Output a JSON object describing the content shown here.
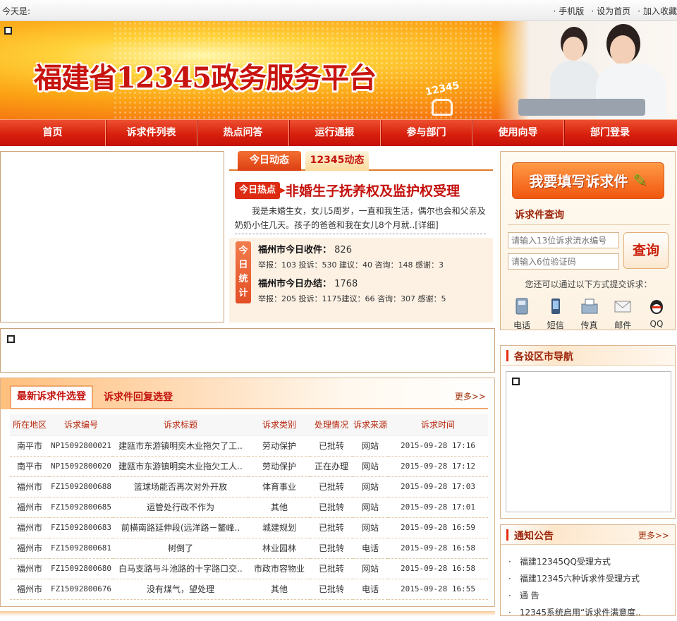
{
  "topbar": {
    "today": "今天是:",
    "links": [
      "手机版",
      "设为首页",
      "加入收藏"
    ]
  },
  "banner": {
    "title": "福建省12345政务服务平台",
    "phone_label": "12345"
  },
  "nav": [
    "首页",
    "诉求件列表",
    "热点问答",
    "运行通报",
    "参与部门",
    "使用向导",
    "部门登录"
  ],
  "news": {
    "tabs": [
      "今日动态",
      "12345动态"
    ],
    "hot_tag": "今日热点",
    "hot_title": "非婚生子抚养权及监护权受理",
    "hot_text": "我是未婚生女，女儿5周岁，一直和我生活，偶尔也会和父亲及奶奶小住几天。孩子的爸爸和我在女儿8个月就..",
    "hot_more": "[详细]",
    "stats_label": "今日统计",
    "stats": [
      {
        "title": "福州市今日收件：",
        "total": "826",
        "details": "举报：103 投诉：530 建议：40  咨询：148 感谢：3"
      },
      {
        "title": "福州市今日办结：",
        "total": "1768",
        "details": "举报：205 投诉：1175建议：66  咨询：307 感谢：5"
      }
    ]
  },
  "sidebar": {
    "fill_button": "我要填写诉求件",
    "query_title": "诉求件查询",
    "serial_placeholder": "请输入13位诉求流水编号",
    "code_placeholder": "请输入6位验证码",
    "query_button": "查询",
    "also_text": "您还可以通过以下方式提交诉求：",
    "ways": [
      "电话",
      "短信",
      "传真",
      "邮件",
      "QQ"
    ],
    "district_title": "各设区市导航",
    "notice_title": "通知公告",
    "notice_more": "更多>>",
    "notices": [
      "福建12345QQ受理方式",
      "福建12345六种诉求件受理方式",
      "通 告",
      "12345系统启用“诉求件满意度.."
    ]
  },
  "list": {
    "tab_active": "最新诉求件选登",
    "tab_other": "诉求件回复选登",
    "more": "更多>>",
    "headers": [
      "所在地区",
      "诉求编号",
      "诉求标题",
      "诉求类别",
      "处理情况",
      "诉求来源",
      "诉求时间"
    ],
    "rows": [
      [
        "南平市",
        "NP15092800021",
        "建瓯市东游镇明奕木业拖欠了工..",
        "劳动保护",
        "已批转",
        "网站",
        "2015-09-28 17:16"
      ],
      [
        "南平市",
        "NP15092800020",
        "建瓯市东游镇明奕木业拖欠工人..",
        "劳动保护",
        "正在办理",
        "网站",
        "2015-09-28 17:12"
      ],
      [
        "福州市",
        "FZ15092800688",
        "篮球场能否再次对外开放",
        "体育事业",
        "已批转",
        "网站",
        "2015-09-28 17:03"
      ],
      [
        "福州市",
        "FZ15092800685",
        "运管处行政不作为",
        "其他",
        "已批转",
        "网站",
        "2015-09-28 17:01"
      ],
      [
        "福州市",
        "FZ15092800683",
        "前横南路延伸段(远洋路－鳌峰..",
        "城建规划",
        "已批转",
        "网站",
        "2015-09-28 16:59"
      ],
      [
        "福州市",
        "FZ15092800681",
        "树倒了",
        "林业园林",
        "已批转",
        "电话",
        "2015-09-28 16:58"
      ],
      [
        "福州市",
        "FZ15092800680",
        "白马支路与斗池路的十字路口交..",
        "市政市容物业",
        "已批转",
        "网站",
        "2015-09-28 16:58"
      ],
      [
        "福州市",
        "FZ15092800676",
        "没有煤气，望处理",
        "其他",
        "已批转",
        "电话",
        "2015-09-28 16:55"
      ]
    ]
  }
}
